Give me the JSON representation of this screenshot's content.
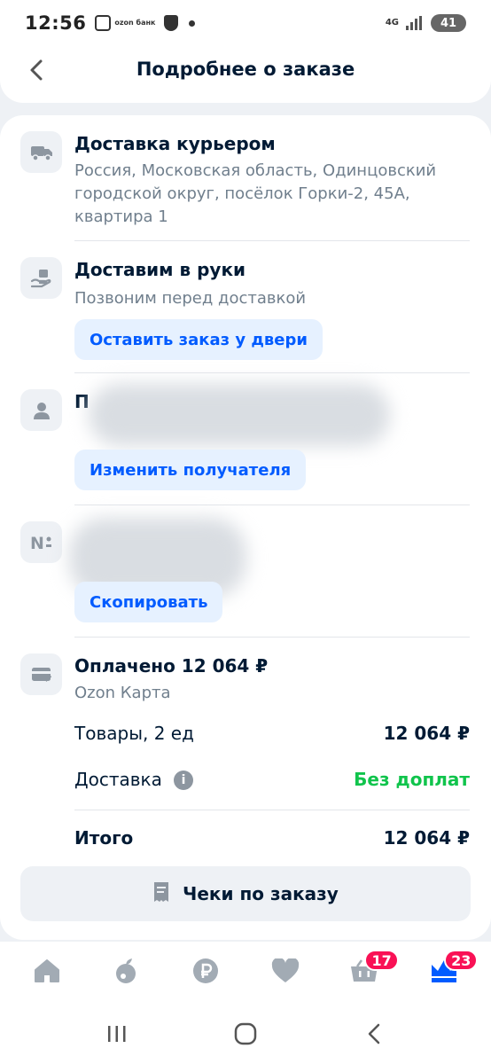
{
  "status_bar": {
    "time": "12:56",
    "ozon_bank": "ozon банк",
    "network": "4G",
    "battery": "41"
  },
  "header": {
    "title": "Подробнее о заказе",
    "back_icon": "chevron-left-icon"
  },
  "delivery": {
    "title": "Доставка курьером",
    "address": "Россия, Московская область, Одинцовский городской округ, посёлок Горки-2, 45А, квартира 1",
    "icon": "truck-icon"
  },
  "handover": {
    "title": "Доставим в руки",
    "subtitle": "Позвоним перед доставкой",
    "button": "Оставить заказ у двери",
    "icon": "hand-package-icon"
  },
  "recipient": {
    "title_visible": "П",
    "button": "Изменить получателя",
    "icon": "person-icon"
  },
  "order_number": {
    "button": "Скопировать",
    "icon": "number-sign-icon"
  },
  "payment": {
    "title": "Оплачено 12 064 ₽",
    "method": "Ozon Карта",
    "icon": "card-icon",
    "items_label": "Товары, 2 ед",
    "items_value": "12 064 ₽",
    "delivery_label": "Доставка",
    "delivery_value": "Без доплат",
    "total_label": "Итого",
    "total_value": "12 064 ₽"
  },
  "receipts": {
    "label": "Чеки по заказу",
    "icon": "receipt-icon"
  },
  "bottom_nav": {
    "items": [
      {
        "icon": "home-icon"
      },
      {
        "icon": "fresh-icon"
      },
      {
        "icon": "ruble-icon"
      },
      {
        "icon": "heart-icon"
      },
      {
        "icon": "cart-icon",
        "badge": "17"
      },
      {
        "icon": "crown-icon",
        "badge": "23"
      }
    ]
  },
  "colors": {
    "accent": "#005bff",
    "accent_bg": "#e6f1ff",
    "success": "#10c44c",
    "badge": "#f91155",
    "text_primary": "#001a34",
    "text_secondary": "#707f8d"
  }
}
